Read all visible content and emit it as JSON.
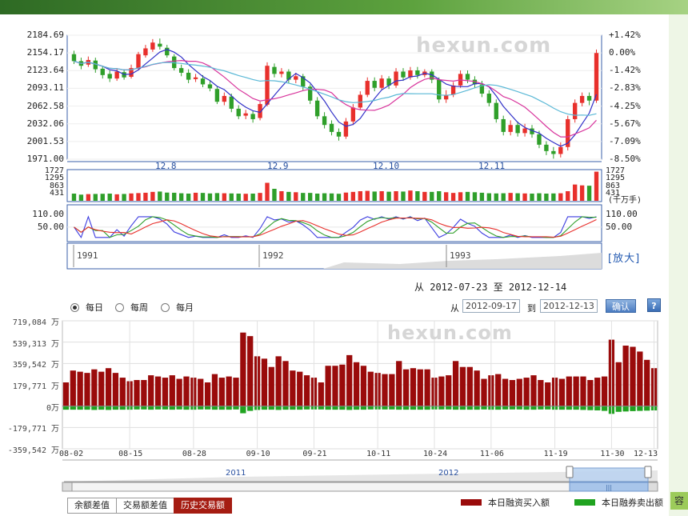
{
  "colors": {
    "up": "#e8302c",
    "down": "#2f9f2a",
    "buy": "#9a0b0b",
    "sell": "#20a320",
    "ma5": "#3030c8",
    "ma10": "#d8349c",
    "ma20": "#5ab8d6",
    "frame": "#3a5fa8"
  },
  "watermark": "hexun.com",
  "kline": {
    "price_ticks": [
      "2184.69",
      "2154.17",
      "2123.64",
      "2093.11",
      "2062.58",
      "2032.06",
      "2001.53",
      "1971.00"
    ],
    "pct_ticks": [
      "+1.42%",
      "0.00%",
      "-1.42%",
      "-2.83%",
      "-4.25%",
      "-5.67%",
      "-7.09%",
      "-8.50%"
    ],
    "month_labels": [
      "12.8",
      "12.9",
      "12.10",
      "12.11"
    ],
    "volume_ticks": [
      "1727",
      "1295",
      "863",
      "431"
    ],
    "volume_unit": "(千万手)",
    "osc_ticks": [
      "110.00",
      "50.00"
    ],
    "year_labels": [
      "1991",
      "1992",
      "1993"
    ],
    "enlarge_label": "[放大]",
    "range_text": "从  2012-07-23  至  2012-12-14",
    "candles": [
      {
        "o": 2152,
        "c": 2140,
        "h": 2158,
        "l": 2135
      },
      {
        "o": 2140,
        "c": 2132,
        "h": 2146,
        "l": 2126
      },
      {
        "o": 2134,
        "c": 2142,
        "h": 2148,
        "l": 2130
      },
      {
        "o": 2141,
        "c": 2126,
        "h": 2146,
        "l": 2120
      },
      {
        "o": 2127,
        "c": 2116,
        "h": 2132,
        "l": 2110
      },
      {
        "o": 2118,
        "c": 2110,
        "h": 2124,
        "l": 2104
      },
      {
        "o": 2110,
        "c": 2122,
        "h": 2128,
        "l": 2106
      },
      {
        "o": 2121,
        "c": 2112,
        "h": 2126,
        "l": 2108
      },
      {
        "o": 2113,
        "c": 2128,
        "h": 2134,
        "l": 2110
      },
      {
        "o": 2127,
        "c": 2152,
        "h": 2156,
        "l": 2124
      },
      {
        "o": 2150,
        "c": 2162,
        "h": 2168,
        "l": 2146
      },
      {
        "o": 2160,
        "c": 2172,
        "h": 2178,
        "l": 2156
      },
      {
        "o": 2170,
        "c": 2165,
        "h": 2179,
        "l": 2160
      },
      {
        "o": 2163,
        "c": 2150,
        "h": 2168,
        "l": 2146
      },
      {
        "o": 2148,
        "c": 2128,
        "h": 2152,
        "l": 2124
      },
      {
        "o": 2128,
        "c": 2120,
        "h": 2134,
        "l": 2114
      },
      {
        "o": 2120,
        "c": 2108,
        "h": 2126,
        "l": 2102
      },
      {
        "o": 2109,
        "c": 2112,
        "h": 2118,
        "l": 2104
      },
      {
        "o": 2110,
        "c": 2100,
        "h": 2116,
        "l": 2095
      },
      {
        "o": 2100,
        "c": 2093,
        "h": 2106,
        "l": 2088
      },
      {
        "o": 2092,
        "c": 2070,
        "h": 2096,
        "l": 2066
      },
      {
        "o": 2070,
        "c": 2080,
        "h": 2086,
        "l": 2064
      },
      {
        "o": 2079,
        "c": 2058,
        "h": 2084,
        "l": 2052
      },
      {
        "o": 2058,
        "c": 2045,
        "h": 2064,
        "l": 2040
      },
      {
        "o": 2046,
        "c": 2050,
        "h": 2056,
        "l": 2040
      },
      {
        "o": 2049,
        "c": 2040,
        "h": 2055,
        "l": 2034
      },
      {
        "o": 2042,
        "c": 2066,
        "h": 2070,
        "l": 2038
      },
      {
        "o": 2065,
        "c": 2132,
        "h": 2138,
        "l": 2062
      },
      {
        "o": 2130,
        "c": 2118,
        "h": 2136,
        "l": 2112
      },
      {
        "o": 2118,
        "c": 2122,
        "h": 2128,
        "l": 2112
      },
      {
        "o": 2122,
        "c": 2108,
        "h": 2126,
        "l": 2102
      },
      {
        "o": 2108,
        "c": 2114,
        "h": 2120,
        "l": 2102
      },
      {
        "o": 2114,
        "c": 2096,
        "h": 2118,
        "l": 2090
      },
      {
        "o": 2096,
        "c": 2072,
        "h": 2100,
        "l": 2066
      },
      {
        "o": 2072,
        "c": 2045,
        "h": 2078,
        "l": 2040
      },
      {
        "o": 2045,
        "c": 2030,
        "h": 2052,
        "l": 2024
      },
      {
        "o": 2032,
        "c": 2018,
        "h": 2038,
        "l": 2012
      },
      {
        "o": 2018,
        "c": 2010,
        "h": 2024,
        "l": 2003
      },
      {
        "o": 2010,
        "c": 2036,
        "h": 2042,
        "l": 2006
      },
      {
        "o": 2036,
        "c": 2060,
        "h": 2066,
        "l": 2030
      },
      {
        "o": 2060,
        "c": 2082,
        "h": 2088,
        "l": 2056
      },
      {
        "o": 2082,
        "c": 2106,
        "h": 2112,
        "l": 2078
      },
      {
        "o": 2106,
        "c": 2094,
        "h": 2112,
        "l": 2088
      },
      {
        "o": 2094,
        "c": 2110,
        "h": 2116,
        "l": 2090
      },
      {
        "o": 2110,
        "c": 2098,
        "h": 2114,
        "l": 2092
      },
      {
        "o": 2098,
        "c": 2122,
        "h": 2128,
        "l": 2094
      },
      {
        "o": 2122,
        "c": 2112,
        "h": 2128,
        "l": 2106
      },
      {
        "o": 2112,
        "c": 2124,
        "h": 2130,
        "l": 2108
      },
      {
        "o": 2124,
        "c": 2116,
        "h": 2130,
        "l": 2110
      },
      {
        "o": 2116,
        "c": 2122,
        "h": 2126,
        "l": 2112
      },
      {
        "o": 2122,
        "c": 2108,
        "h": 2126,
        "l": 2102
      },
      {
        "o": 2108,
        "c": 2074,
        "h": 2112,
        "l": 2068
      },
      {
        "o": 2074,
        "c": 2082,
        "h": 2090,
        "l": 2068
      },
      {
        "o": 2082,
        "c": 2098,
        "h": 2104,
        "l": 2078
      },
      {
        "o": 2098,
        "c": 2118,
        "h": 2124,
        "l": 2094
      },
      {
        "o": 2118,
        "c": 2108,
        "h": 2124,
        "l": 2102
      },
      {
        "o": 2108,
        "c": 2100,
        "h": 2114,
        "l": 2094
      },
      {
        "o": 2100,
        "c": 2084,
        "h": 2106,
        "l": 2078
      },
      {
        "o": 2084,
        "c": 2068,
        "h": 2090,
        "l": 2062
      },
      {
        "o": 2068,
        "c": 2040,
        "h": 2074,
        "l": 2034
      },
      {
        "o": 2040,
        "c": 2018,
        "h": 2046,
        "l": 2012
      },
      {
        "o": 2018,
        "c": 2030,
        "h": 2038,
        "l": 2012
      },
      {
        "o": 2030,
        "c": 2016,
        "h": 2036,
        "l": 2010
      },
      {
        "o": 2016,
        "c": 2024,
        "h": 2032,
        "l": 2010
      },
      {
        "o": 2024,
        "c": 2014,
        "h": 2030,
        "l": 2008
      },
      {
        "o": 2014,
        "c": 1996,
        "h": 2020,
        "l": 1990
      },
      {
        "o": 1996,
        "c": 1985,
        "h": 2002,
        "l": 1978
      },
      {
        "o": 1985,
        "c": 1980,
        "h": 1992,
        "l": 1972
      },
      {
        "o": 1980,
        "c": 1992,
        "h": 2000,
        "l": 1974
      },
      {
        "o": 1992,
        "c": 2040,
        "h": 2046,
        "l": 1986
      },
      {
        "o": 2040,
        "c": 2068,
        "h": 2074,
        "l": 2034
      },
      {
        "o": 2068,
        "c": 2080,
        "h": 2086,
        "l": 2062
      },
      {
        "o": 2080,
        "c": 2072,
        "h": 2086,
        "l": 2064
      },
      {
        "o": 2072,
        "c": 2154,
        "h": 2160,
        "l": 2068
      }
    ],
    "volumes": [
      420,
      360,
      390,
      400,
      410,
      420,
      380,
      400,
      430,
      450,
      470,
      520,
      540,
      480,
      470,
      440,
      420,
      470,
      460,
      430,
      450,
      440,
      430,
      420,
      410,
      420,
      460,
      1050,
      700,
      560,
      520,
      500,
      460,
      460,
      420,
      440,
      430,
      410,
      480,
      520,
      560,
      580,
      540,
      560,
      530,
      560,
      540,
      600,
      560,
      520,
      520,
      560,
      500,
      460,
      500,
      520,
      500,
      470,
      440,
      430,
      440,
      460,
      440,
      430,
      420,
      440,
      420,
      430,
      440,
      560,
      950,
      900,
      880,
      1700
    ]
  },
  "controls": {
    "freq_options": [
      "每日",
      "每周",
      "每月"
    ],
    "selected": "每日",
    "from_label": "从",
    "to_label": "到",
    "from_date": "2012-09-17",
    "to_date": "2012-12-13",
    "confirm": "确认",
    "help": "?"
  },
  "chart_data": {
    "type": "bar",
    "title": "",
    "yticks": [
      "719,084 万",
      "539,313 万",
      "359,542 万",
      "179,771 万",
      "0万",
      "-179,771 万",
      "-359,542 万"
    ],
    "xticks": [
      "08-02",
      "08-15",
      "08-28",
      "09-10",
      "09-21",
      "10-11",
      "10-24",
      "11-06",
      "11-19",
      "11-30",
      "12-13"
    ],
    "ylim": [
      -359542,
      719084
    ],
    "unit": "万",
    "series": [
      {
        "name": "本日融资买入额",
        "values": [
          200000,
          300000,
          290000,
          280000,
          310000,
          290000,
          320000,
          280000,
          240000,
          210000,
          220000,
          220000,
          260000,
          250000,
          240000,
          260000,
          230000,
          250000,
          240000,
          230000,
          200000,
          270000,
          240000,
          250000,
          240000,
          620000,
          590000,
          420000,
          400000,
          330000,
          420000,
          380000,
          300000,
          290000,
          260000,
          240000,
          200000,
          340000,
          340000,
          350000,
          430000,
          370000,
          340000,
          290000,
          280000,
          270000,
          270000,
          380000,
          310000,
          320000,
          310000,
          310000,
          240000,
          250000,
          260000,
          380000,
          330000,
          330000,
          300000,
          230000,
          260000,
          270000,
          230000,
          220000,
          230000,
          240000,
          260000,
          220000,
          200000,
          240000,
          230000,
          250000,
          250000,
          250000,
          220000,
          240000,
          250000,
          560000,
          370000,
          510000,
          500000,
          460000,
          390000,
          320000
        ]
      },
      {
        "name": "本日融券卖出额",
        "values": [
          -30000,
          -30000,
          -30000,
          -30000,
          -32000,
          -30000,
          -32000,
          -30000,
          -30000,
          -30000,
          -28000,
          -28000,
          -30000,
          -28000,
          -28000,
          -30000,
          -28000,
          -30000,
          -30000,
          -28000,
          -28000,
          -30000,
          -30000,
          -30000,
          -28000,
          -60000,
          -40000,
          -32000,
          -30000,
          -30000,
          -32000,
          -30000,
          -30000,
          -30000,
          -28000,
          -28000,
          -28000,
          -30000,
          -30000,
          -30000,
          -32000,
          -30000,
          -30000,
          -28000,
          -28000,
          -28000,
          -28000,
          -30000,
          -30000,
          -30000,
          -30000,
          -30000,
          -28000,
          -28000,
          -28000,
          -30000,
          -30000,
          -30000,
          -30000,
          -28000,
          -30000,
          -30000,
          -28000,
          -28000,
          -28000,
          -30000,
          -30000,
          -28000,
          -28000,
          -30000,
          -30000,
          -30000,
          -30000,
          -32000,
          -34000,
          -36000,
          -40000,
          -65000,
          -48000,
          -45000,
          -42000,
          -40000,
          -38000,
          -36000
        ]
      }
    ]
  },
  "navigator": {
    "years": [
      "2011",
      "2012"
    ],
    "handle_glyph": "|||"
  },
  "tabs": [
    "余额差值",
    "交易额差值",
    "历史交易额"
  ],
  "active_tab": "历史交易额",
  "legend": [
    "本日融资买入额",
    "本日融券卖出额"
  ],
  "corner_glyph": "容"
}
